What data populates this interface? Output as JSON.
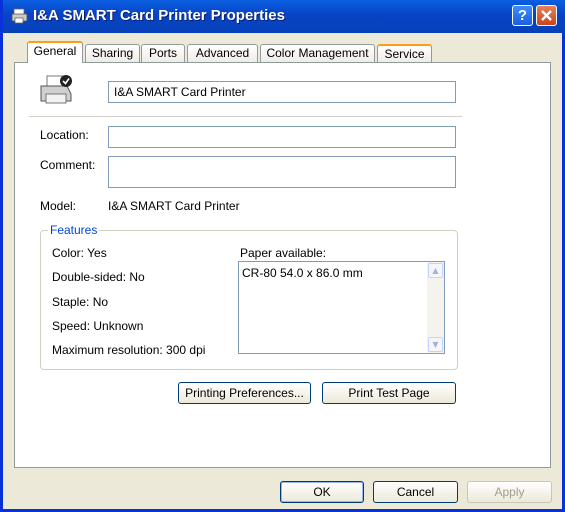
{
  "window": {
    "title": "I&A SMART Card Printer Properties",
    "help_label": "?",
    "close_label": "✕"
  },
  "tabs": [
    {
      "label": "General",
      "active": true
    },
    {
      "label": "Sharing"
    },
    {
      "label": "Ports"
    },
    {
      "label": "Advanced"
    },
    {
      "label": "Color Management"
    },
    {
      "label": "Service"
    }
  ],
  "general": {
    "printer_name": "I&A SMART Card Printer",
    "location_label": "Location:",
    "location_value": "",
    "comment_label": "Comment:",
    "comment_value": "",
    "model_label": "Model:",
    "model_value": "I&A SMART Card Printer",
    "features_title": "Features",
    "color": "Color: Yes",
    "double_sided": "Double-sided: No",
    "staple": "Staple: No",
    "speed": "Speed: Unknown",
    "max_resolution": "Maximum resolution: 300 dpi",
    "paper_available_label": "Paper available:",
    "paper_items": [
      "CR-80 54.0 x 86.0 mm"
    ],
    "printing_preferences_label": "Printing Preferences...",
    "print_test_page_label": "Print Test Page"
  },
  "footer": {
    "ok_label": "OK",
    "cancel_label": "Cancel",
    "apply_label": "Apply"
  },
  "colors": {
    "titlebar": "#0843c6",
    "active_tab_accent": "#ff9c1a",
    "group_title": "#0046d5"
  }
}
